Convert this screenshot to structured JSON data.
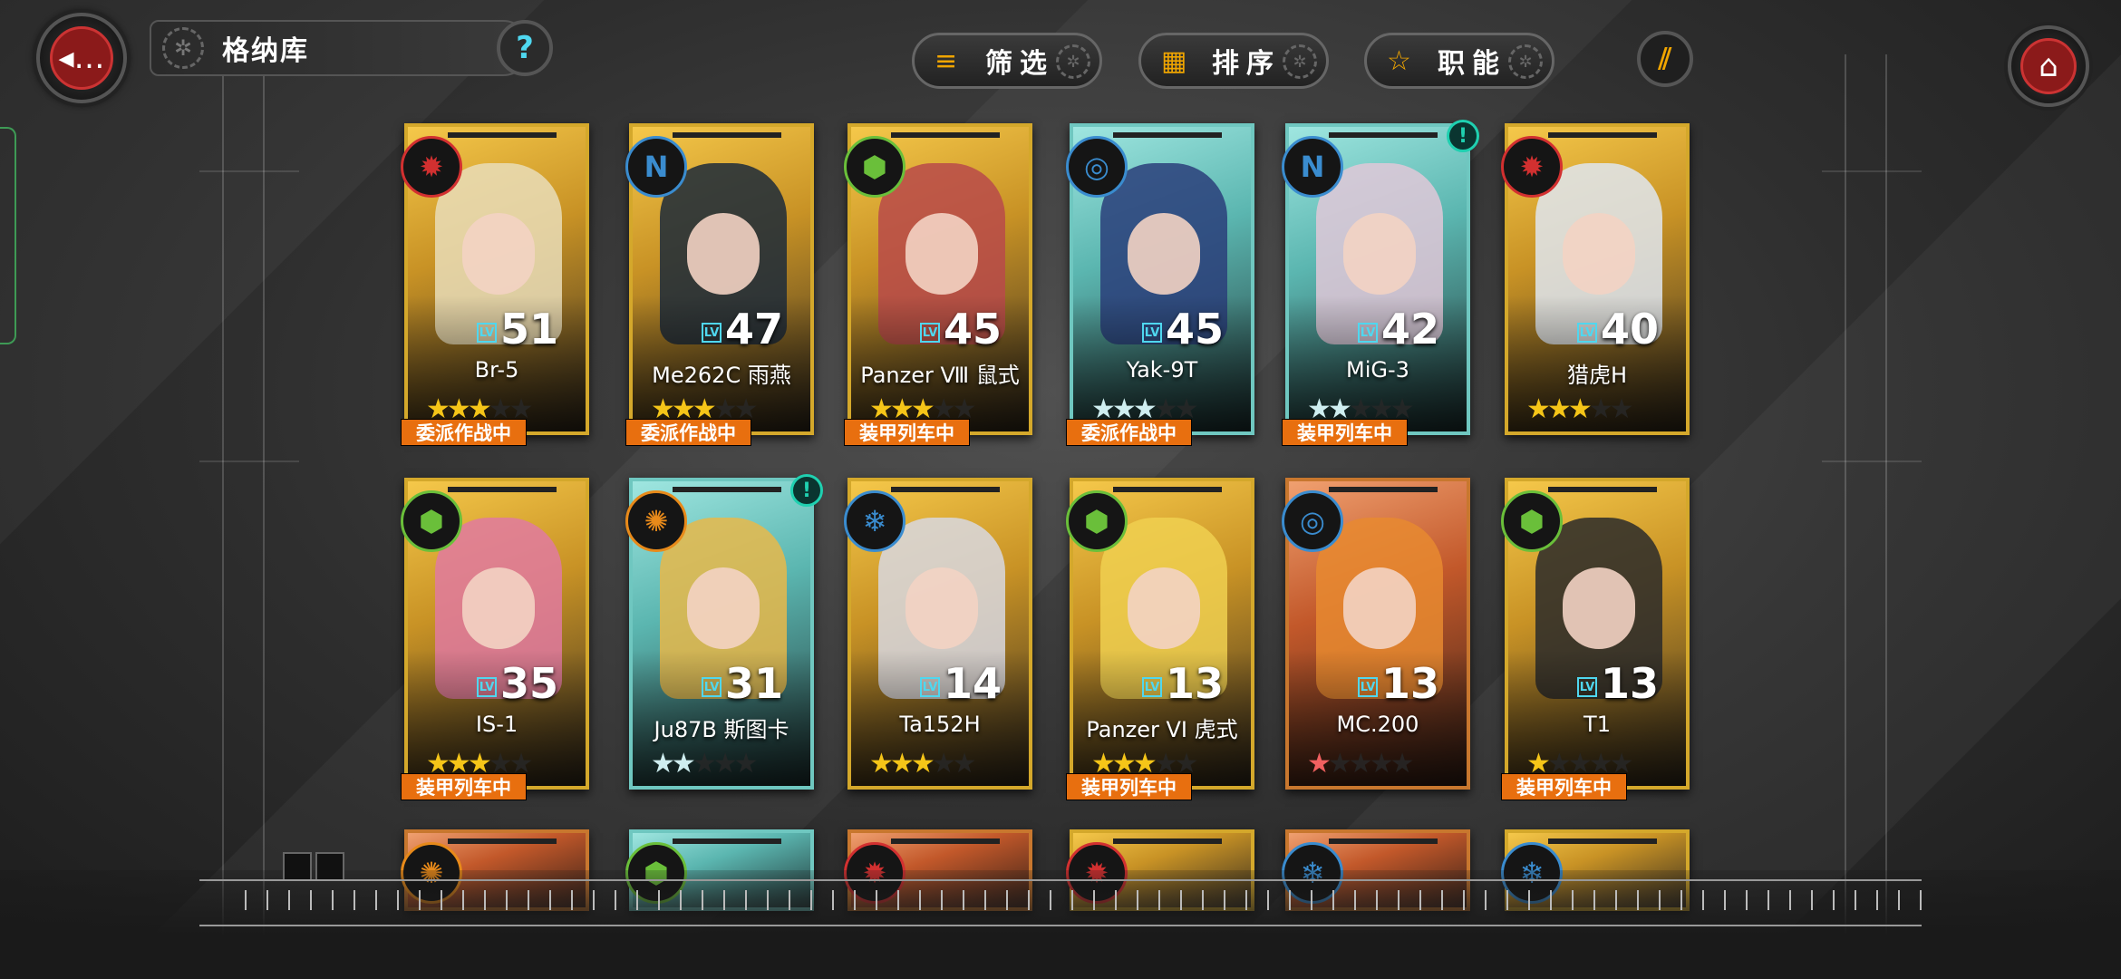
{
  "header": {
    "title": "格纳库",
    "help_glyph": "?",
    "back_glyph": "◂…",
    "home_glyph": "⌂",
    "buttons": [
      {
        "label": "筛选",
        "icon": "filter-lines-icon"
      },
      {
        "label": "排序",
        "icon": "grid-squares-icon"
      },
      {
        "label": "职能",
        "icon": "star-outline-icon"
      }
    ]
  },
  "colors": {
    "accent_orange": "#f0a500",
    "status_orange": "#e86f0f",
    "cyan": "#4fd7ef",
    "gold_border": "#d4a82b",
    "teal_border": "#6fc7c0"
  },
  "units": [
    {
      "name": "Br-5",
      "level": "51",
      "stars": "★★★",
      "status": "委派作战中",
      "class_icon": "red-gear-icon",
      "badge_color": "#d23030",
      "rarity": "gold",
      "alert": false
    },
    {
      "name": "Me262C 雨燕",
      "level": "47",
      "stars": "★★★",
      "status": "委派作战中",
      "class_icon": "blue-n-icon",
      "badge_color": "#3a8ccf",
      "rarity": "gold",
      "alert": false
    },
    {
      "name": "Panzer Ⅷ 鼠式",
      "level": "45",
      "stars": "★★★",
      "status": "装甲列车中",
      "class_icon": "green-shield-icon",
      "badge_color": "#6abf3a",
      "rarity": "gold",
      "alert": false
    },
    {
      "name": "Yak-9T",
      "level": "45",
      "stars": "★★★",
      "status": "委派作战中",
      "class_icon": "blue-target-icon",
      "badge_color": "#3a8ccf",
      "rarity": "teal",
      "alert": false
    },
    {
      "name": "MiG-3",
      "level": "42",
      "stars": "★★",
      "status": "装甲列车中",
      "class_icon": "blue-n-icon",
      "badge_color": "#3a8ccf",
      "rarity": "teal",
      "alert": true
    },
    {
      "name": "猎虎H",
      "level": "40",
      "stars": "★★★",
      "status": "",
      "class_icon": "red-gear-icon",
      "badge_color": "#d23030",
      "rarity": "gold",
      "alert": false
    },
    {
      "name": "IS-1",
      "level": "35",
      "stars": "★★★",
      "status": "装甲列车中",
      "class_icon": "green-shield-icon",
      "badge_color": "#6abf3a",
      "rarity": "gold",
      "alert": false
    },
    {
      "name": "Ju87B 斯图卡",
      "level": "31",
      "stars": "★★",
      "status": "",
      "class_icon": "orange-flame-icon",
      "badge_color": "#e88a1a",
      "rarity": "teal",
      "alert": true
    },
    {
      "name": "Ta152H",
      "level": "14",
      "stars": "★★★",
      "status": "",
      "class_icon": "blue-snowflake-icon",
      "badge_color": "#3a8ccf",
      "rarity": "gold",
      "alert": false
    },
    {
      "name": "Panzer VI 虎式",
      "level": "13",
      "stars": "★★★",
      "status": "装甲列车中",
      "class_icon": "green-shield-icon",
      "badge_color": "#6abf3a",
      "rarity": "gold",
      "alert": false
    },
    {
      "name": "MC.200",
      "level": "13",
      "stars": "★",
      "status": "",
      "class_icon": "blue-target-icon",
      "badge_color": "#3a8ccf",
      "rarity": "orange",
      "alert": false
    },
    {
      "name": "T1",
      "level": "13",
      "stars": "★",
      "status": "装甲列车中",
      "class_icon": "green-shield-icon",
      "badge_color": "#6abf3a",
      "rarity": "gold",
      "alert": false
    }
  ],
  "partial_units": [
    {
      "class_icon": "orange-flame-icon",
      "badge_color": "#e88a1a",
      "rarity": "orange"
    },
    {
      "class_icon": "green-shield-icon",
      "badge_color": "#6abf3a",
      "rarity": "teal"
    },
    {
      "class_icon": "red-gear-icon",
      "badge_color": "#d23030",
      "rarity": "orange"
    },
    {
      "class_icon": "red-gear-icon",
      "badge_color": "#d23030",
      "rarity": "gold"
    },
    {
      "class_icon": "blue-snowflake-icon",
      "badge_color": "#3a8ccf",
      "rarity": "orange"
    },
    {
      "class_icon": "blue-snowflake-icon",
      "badge_color": "#3a8ccf",
      "rarity": "gold"
    }
  ]
}
